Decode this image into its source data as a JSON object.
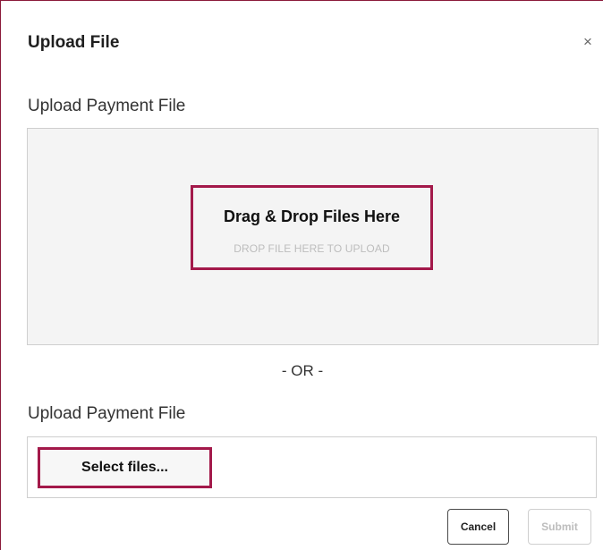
{
  "dialog": {
    "title": "Upload File",
    "close_label": "×"
  },
  "dropzone": {
    "label": "Upload Payment File",
    "title": "Drag & Drop Files Here",
    "hint": "DROP FILE HERE TO UPLOAD"
  },
  "divider": {
    "text": "- OR -"
  },
  "file_picker": {
    "label": "Upload Payment File",
    "button_label": "Select files..."
  },
  "footer": {
    "cancel_label": "Cancel",
    "submit_label": "Submit"
  },
  "colors": {
    "highlight": "#a3194a",
    "dialog_border": "#8b1a3a",
    "dropzone_bg": "#f4f4f4"
  },
  "icons": {
    "close": "close-icon"
  }
}
